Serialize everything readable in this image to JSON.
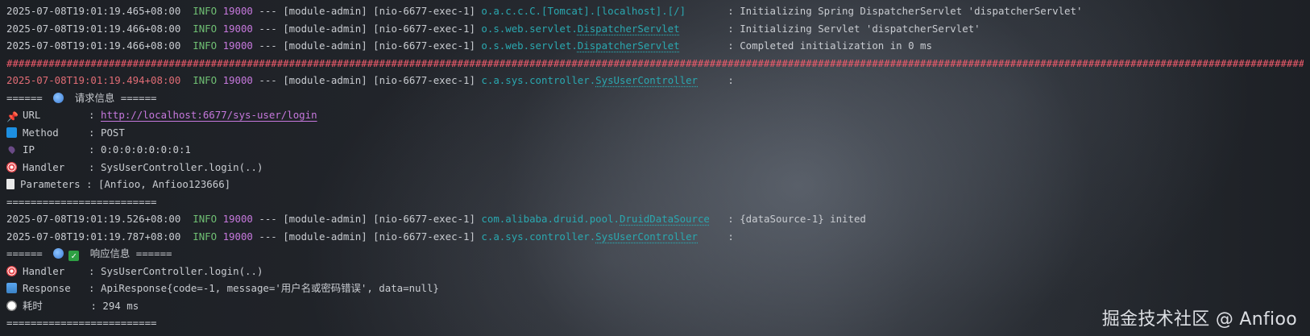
{
  "log": {
    "line1": {
      "timestamp": "2025-07-08T19:01:19.465+08:00",
      "level": "INFO",
      "pid": "19000",
      "sep": "---",
      "app": "[module-admin]",
      "thread": "[nio-6677-exec-1]",
      "logger_pkg": "o.a.c.c.C.[Tomcat].[localhost].[/]",
      "logger_cls": "",
      "message": ": Initializing Spring DispatcherServlet 'dispatcherServlet'"
    },
    "line2": {
      "timestamp": "2025-07-08T19:01:19.466+08:00",
      "level": "INFO",
      "pid": "19000",
      "sep": "---",
      "app": "[module-admin]",
      "thread": "[nio-6677-exec-1]",
      "logger_pkg": "o.s.web.servlet.",
      "logger_cls": "DispatcherServlet",
      "message": ": Initializing Servlet 'dispatcherServlet'"
    },
    "line3": {
      "timestamp": "2025-07-08T19:01:19.466+08:00",
      "level": "INFO",
      "pid": "19000",
      "sep": "---",
      "app": "[module-admin]",
      "thread": "[nio-6677-exec-1]",
      "logger_pkg": "o.s.web.servlet.",
      "logger_cls": "DispatcherServlet",
      "message": ": Completed initialization in 0 ms"
    },
    "hash_line": "##########################################################################################################################################################################################################################",
    "line5": {
      "timestamp": "2025-07-08T19:01:19.494+08:00",
      "level": "INFO",
      "pid": "19000",
      "sep": "---",
      "app": "[module-admin]",
      "thread": "[nio-6677-exec-1]",
      "logger_pkg": "c.a.sys.controller.",
      "logger_cls": "SysUserController",
      "message": ":"
    },
    "request_header": {
      "left": "======",
      "label": "请求信息",
      "right": "======"
    },
    "request": {
      "url_key": "URL        :",
      "url_value": "http://localhost:6677/sys-user/login",
      "method_key": "Method     :",
      "method_value": "POST",
      "ip_key": "IP         :",
      "ip_value": "0:0:0:0:0:0:0:1",
      "handler_key": "Handler    :",
      "handler_value": "SysUserController.login(..)",
      "params_key": "Parameters :",
      "params_value": "[Anfioo, Anfioo123666]"
    },
    "divider1": "=========================",
    "line12": {
      "timestamp": "2025-07-08T19:01:19.526+08:00",
      "level": "INFO",
      "pid": "19000",
      "sep": "---",
      "app": "[module-admin]",
      "thread": "[nio-6677-exec-1]",
      "logger_pkg": "com.alibaba.druid.pool.",
      "logger_cls": "DruidDataSource",
      "message": ": {dataSource-1} inited"
    },
    "line13": {
      "timestamp": "2025-07-08T19:01:19.787+08:00",
      "level": "INFO",
      "pid": "19000",
      "sep": "---",
      "app": "[module-admin]",
      "thread": "[nio-6677-exec-1]",
      "logger_pkg": "c.a.sys.controller.",
      "logger_cls": "SysUserController",
      "message": ":"
    },
    "response_header": {
      "left": "======",
      "label": "响应信息",
      "right": "======"
    },
    "response": {
      "handler_key": "Handler    :",
      "handler_value": "SysUserController.login(..)",
      "resp_key": "Response   :",
      "resp_value": "ApiResponse{code=-1, message='用户名或密码错误', data=null}",
      "time_key": "耗时        :",
      "time_value": "294 ms"
    },
    "divider2": "========================="
  },
  "watermark": "掘金技术社区 @ Anfioo",
  "icons": {
    "globe": "globe-icon",
    "pin": "pushpin-icon",
    "method": "arrows-cycle-icon",
    "ip": "location-pin-icon",
    "handler": "target-icon",
    "parameters": "document-icon",
    "check": "check-box-icon",
    "response": "inbox-icon",
    "time": "stopwatch-icon"
  }
}
